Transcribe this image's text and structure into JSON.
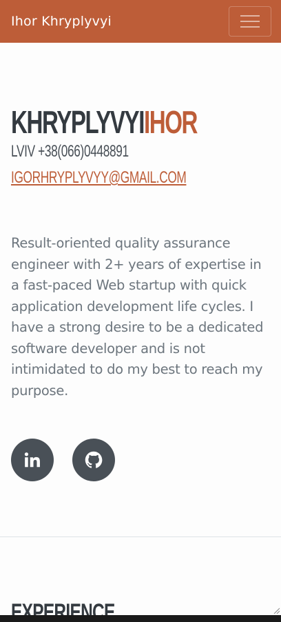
{
  "navbar": {
    "brand": "Ihor Khryplyvyi",
    "toggle_icon": "hamburger-icon"
  },
  "about": {
    "last_name": "Khryplyvyi",
    "first_name": "Ihor",
    "location_phone": "Lviv +38(066)0448891",
    "email": "igorhryplyvyy@gmail.com",
    "summary": "Result-oriented quality assurance engineer with 2+ years of expertise in a fast-paced Web startup with quick application development life cycles. I have a strong desire to be a dedicated software developer and is not intimidated to do my best to reach my purpose."
  },
  "social": [
    {
      "icon": "linkedin-icon"
    },
    {
      "icon": "github-icon"
    }
  ],
  "experience": {
    "title": "Experience"
  },
  "colors": {
    "primary": "#bd5d38",
    "text": "#343a40",
    "muted": "#6c757d",
    "social_bg": "#495057"
  }
}
